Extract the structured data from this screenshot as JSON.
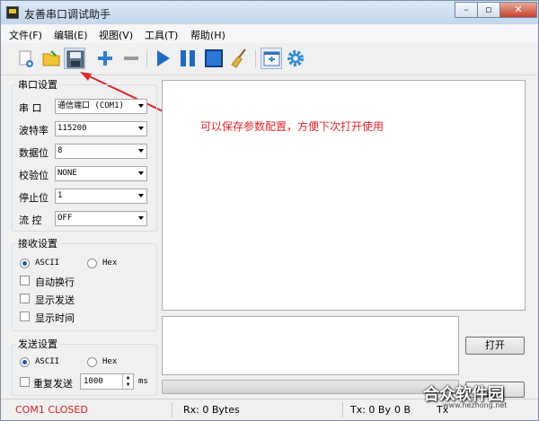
{
  "window": {
    "title": "友善串口调试助手"
  },
  "menu": [
    "文件(F)",
    "编辑(E)",
    "视图(V)",
    "工具(T)",
    "帮助(H)"
  ],
  "serial_settings": {
    "legend": "串口设置",
    "port_label": "串  口",
    "port_value": "通信端口 (COM1)",
    "baud_label": "波特率",
    "baud_value": "115200",
    "databits_label": "数据位",
    "databits_value": "8",
    "parity_label": "校验位",
    "parity_value": "NONE",
    "stopbits_label": "停止位",
    "stopbits_value": "1",
    "flow_label": "流  控",
    "flow_value": "OFF"
  },
  "receive_settings": {
    "legend": "接收设置",
    "ascii": "ASCII",
    "hex": "Hex",
    "auto_wrap": "自动换行",
    "show_send": "显示发送",
    "show_time": "显示时间"
  },
  "send_settings": {
    "legend": "发送设置",
    "ascii": "ASCII",
    "hex": "Hex",
    "repeat": "重复发送",
    "interval": "1000",
    "unit": "ms"
  },
  "annotation": "可以保存参数配置，方便下次打开使用",
  "buttons": {
    "open": "打开",
    "open2": "打开"
  },
  "status": {
    "port": "COM1 CLOSED",
    "rx": "Rx: 0 Bytes",
    "tx": "Tx: 0 By",
    "tx_tail": "0 B",
    "tx3": "Tx"
  },
  "watermark": {
    "text": "合众软件园",
    "url": "www.hezhong.net"
  },
  "colors": {
    "annotation": "#e0262a",
    "status_closed": "#d42222",
    "accent": "#1e5ab4"
  }
}
